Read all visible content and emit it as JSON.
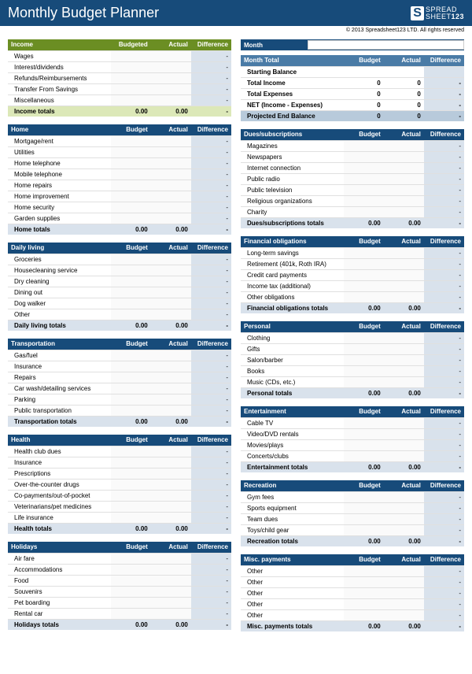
{
  "title": "Monthly Budget Planner",
  "logo": {
    "mark": "S",
    "line1": "SPREAD",
    "line2": "SHEET",
    "suffix": "123"
  },
  "copyright": "© 2013 Spreadsheet123 LTD. All rights reserved",
  "headers": {
    "budgeted": "Budgeted",
    "budget": "Budget",
    "actual": "Actual",
    "difference": "Difference"
  },
  "month_section": {
    "label": "Month",
    "value": "",
    "header": "Month Total",
    "rows": [
      {
        "label": "Starting Balance",
        "b": "",
        "a": "",
        "d": ""
      },
      {
        "label": "Total Income",
        "b": "0",
        "a": "0",
        "d": "-",
        "bold": true
      },
      {
        "label": "Total Expenses",
        "b": "0",
        "a": "0",
        "d": "-",
        "bold": true
      },
      {
        "label": "NET (Income - Expenses)",
        "b": "0",
        "a": "0",
        "d": "-",
        "bold": true
      }
    ],
    "projected": {
      "label": "Projected End Balance",
      "b": "0",
      "a": "0",
      "d": "-"
    }
  },
  "left_sections": [
    {
      "title": "Income",
      "green": true,
      "budget_label": "Budgeted",
      "items": [
        "Wages",
        "Interest/dividends",
        "Refunds/Reimbursements",
        "Transfer From Savings",
        "Miscellaneous"
      ],
      "totals_label": "Income totals",
      "b": "0.00",
      "a": "0.00",
      "d": "-",
      "total_green": true
    },
    {
      "title": "Home",
      "items": [
        "Mortgage/rent",
        "Utilities",
        "Home telephone",
        "Mobile telephone",
        "Home repairs",
        "Home improvement",
        "Home security",
        "Garden supplies"
      ],
      "totals_label": "Home totals",
      "b": "0.00",
      "a": "0.00",
      "d": "-"
    },
    {
      "title": "Daily living",
      "items": [
        "Groceries",
        "Housecleaning service",
        "Dry cleaning",
        "Dining out",
        "Dog walker",
        "Other"
      ],
      "totals_label": "Daily living totals",
      "b": "0.00",
      "a": "0.00",
      "d": "-"
    },
    {
      "title": "Transportation",
      "items": [
        "Gas/fuel",
        "Insurance",
        "Repairs",
        "Car wash/detailing services",
        "Parking",
        "Public transportation"
      ],
      "totals_label": "Transportation totals",
      "b": "0.00",
      "a": "0.00",
      "d": "-"
    },
    {
      "title": "Health",
      "items": [
        "Health club dues",
        "Insurance",
        "Prescriptions",
        "Over-the-counter drugs",
        "Co-payments/out-of-pocket",
        "Veterinarians/pet medicines",
        "Life insurance"
      ],
      "totals_label": "Health totals",
      "b": "0.00",
      "a": "0.00",
      "d": "-"
    },
    {
      "title": "Holidays",
      "items": [
        "Air fare",
        "Accommodations",
        "Food",
        "Souvenirs",
        "Pet boarding",
        "Rental car"
      ],
      "totals_label": "Holidays totals",
      "b": "0.00",
      "a": "0.00",
      "d": "-"
    }
  ],
  "right_sections": [
    {
      "title": "Dues/subscriptions",
      "items": [
        "Magazines",
        "Newspapers",
        "Internet connection",
        "Public radio",
        "Public television",
        "Religious organizations",
        "Charity"
      ],
      "totals_label": "Dues/subscriptions totals",
      "b": "0.00",
      "a": "0.00",
      "d": "-"
    },
    {
      "title": "Financial obligations",
      "items": [
        "Long-term savings",
        "Retirement (401k, Roth IRA)",
        "Credit card payments",
        "Income tax (additional)",
        "Other obligations"
      ],
      "totals_label": "Financial obligations totals",
      "b": "0.00",
      "a": "0.00",
      "d": "-"
    },
    {
      "title": "Personal",
      "items": [
        "Clothing",
        "Gifts",
        "Salon/barber",
        "Books",
        "Music (CDs, etc.)"
      ],
      "totals_label": "Personal totals",
      "b": "0.00",
      "a": "0.00",
      "d": "-"
    },
    {
      "title": "Entertainment",
      "items": [
        "Cable TV",
        "Video/DVD rentals",
        "Movies/plays",
        "Concerts/clubs"
      ],
      "totals_label": "Entertainment totals",
      "b": "0.00",
      "a": "0.00",
      "d": "-"
    },
    {
      "title": "Recreation",
      "items": [
        "Gym fees",
        "Sports equipment",
        "Team dues",
        "Toys/child gear"
      ],
      "totals_label": "Recreation totals",
      "b": "0.00",
      "a": "0.00",
      "d": "-"
    },
    {
      "title": "Misc. payments",
      "items": [
        "Other",
        "Other",
        "Other",
        "Other",
        "Other"
      ],
      "totals_label": "Misc. payments totals",
      "b": "0.00",
      "a": "0.00",
      "d": "-"
    }
  ]
}
